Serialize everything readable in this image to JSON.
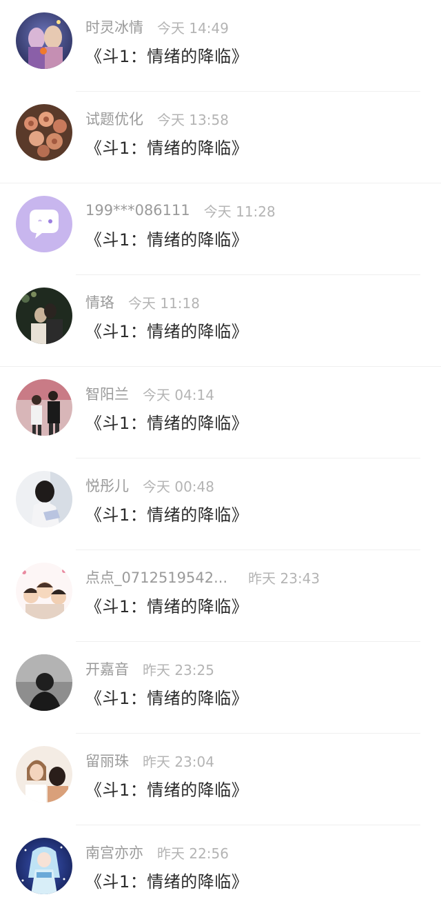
{
  "messages": [
    {
      "username": "时灵冰情",
      "time": "今天 14:49",
      "text": "《斗1：情绪的降临》",
      "avatar": "fantasy-art-avatar"
    },
    {
      "username": "试题优化",
      "time": "今天 13:58",
      "text": "《斗1：情绪的降临》",
      "avatar": "flowers-avatar"
    },
    {
      "username": "199***086111",
      "time": "今天 11:28",
      "text": "《斗1：情绪的降临》",
      "avatar": "default-chat-bubble-avatar"
    },
    {
      "username": "情珞",
      "time": "今天 11:18",
      "text": "《斗1：情绪的降临》",
      "avatar": "couple-photo-avatar"
    },
    {
      "username": "智阳兰",
      "time": "今天 04:14",
      "text": "《斗1：情绪的降临》",
      "avatar": "couple-standing-avatar"
    },
    {
      "username": "悦彤儿",
      "time": "今天 00:48",
      "text": "《斗1：情绪的降临》",
      "avatar": "girl-photo-avatar"
    },
    {
      "username": "点点_0712519542...",
      "time": "昨天 23:43",
      "text": "《斗1：情绪的降临》",
      "avatar": "cartoon-group-avatar"
    },
    {
      "username": "开嘉音",
      "time": "昨天 23:25",
      "text": "《斗1：情绪的降临》",
      "avatar": "silhouette-avatar"
    },
    {
      "username": "留丽珠",
      "time": "昨天 23:04",
      "text": "《斗1：情绪的降临》",
      "avatar": "girls-photo-avatar"
    },
    {
      "username": "南宫亦亦",
      "time": "昨天 22:56",
      "text": "《斗1：情绪的降临》",
      "avatar": "anime-girl-avatar"
    }
  ],
  "colors": {
    "username": "#9a9a9a",
    "time": "#b4b4b4",
    "message": "#2b2b2b",
    "divider": "#efefef",
    "default_avatar_bg": "#c8b6ee"
  }
}
